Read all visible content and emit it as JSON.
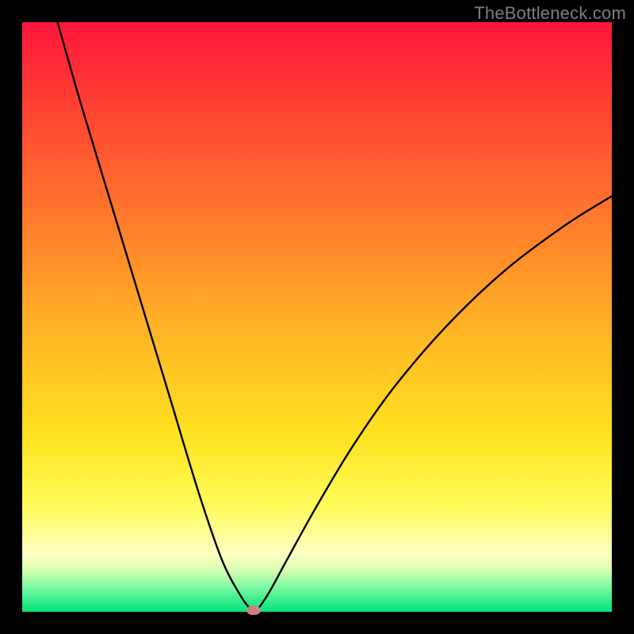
{
  "watermark": "TheBottleneck.com",
  "chart_data": {
    "type": "line",
    "title": "",
    "xlabel": "",
    "ylabel": "",
    "xlim": [
      0,
      100
    ],
    "ylim": [
      0,
      100
    ],
    "grid": false,
    "legend": false,
    "series": [
      {
        "name": "curve",
        "x": [
          6,
          10,
          15,
          20,
          25,
          30,
          34,
          37,
          38.5,
          39.3,
          40,
          42,
          45,
          50,
          56,
          63,
          72,
          82,
          92,
          100
        ],
        "y": [
          100,
          86,
          69.5,
          53,
          36.5,
          20,
          8.5,
          2.8,
          0.7,
          0,
          0.5,
          3.5,
          9,
          18,
          28,
          38,
          48.5,
          58,
          65.5,
          70.5
        ]
      }
    ],
    "marker": {
      "x": 39.3,
      "y": 0.3,
      "color": "#d08080"
    },
    "background_gradient": [
      {
        "pos": 0,
        "color": "#ff153b"
      },
      {
        "pos": 30,
        "color": "#ff6f2d"
      },
      {
        "pos": 50,
        "color": "#ffae26"
      },
      {
        "pos": 70,
        "color": "#ffe21f"
      },
      {
        "pos": 90,
        "color": "#ffffc0"
      },
      {
        "pos": 100,
        "color": "#00e37e"
      }
    ]
  }
}
